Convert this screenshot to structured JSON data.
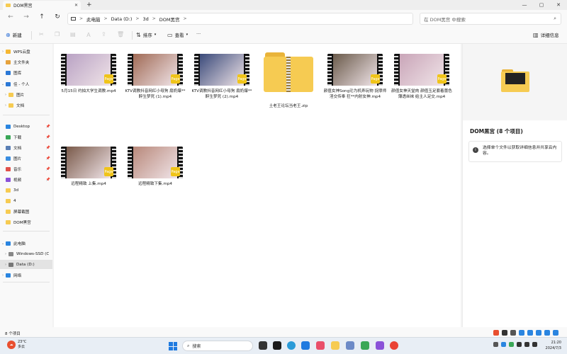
{
  "window": {
    "tab_title": "DOM黑宫",
    "tab_close": "✕",
    "new_tab": "+",
    "min": "—",
    "max": "▢",
    "close": "✕"
  },
  "nav": {
    "back": "←",
    "forward": "→",
    "up": "↑",
    "refresh": "↻"
  },
  "address": {
    "crumbs": [
      "此电脑",
      "Data (D:)",
      "3d",
      "DOM黑宫"
    ],
    "separator": ">"
  },
  "search": {
    "placeholder": "在 DOM黑宫 中搜索"
  },
  "toolbar": {
    "new_label": "新建",
    "sort_label": "排序",
    "view_label": "查看",
    "more_label": "···",
    "details_label": "详细信息"
  },
  "sidebar": {
    "items": [
      {
        "label": "WPS云盘",
        "color": "#f5b733"
      },
      {
        "label": "主文件夹",
        "color": "#e6a23c"
      },
      {
        "label": "图库",
        "color": "#2b78d6"
      },
      {
        "label": "佳 - 个人",
        "color": "#2b78d6"
      },
      {
        "label": "图片",
        "color": "#f6cb52"
      },
      {
        "label": "文档",
        "color": "#f6cb52"
      },
      {
        "label": "Desktop",
        "color": "#2a85e0"
      },
      {
        "label": "下载",
        "color": "#3aa757"
      },
      {
        "label": "文档",
        "color": "#5a7fb5"
      },
      {
        "label": "图片",
        "color": "#3a8de0"
      },
      {
        "label": "音乐",
        "color": "#e0504a"
      },
      {
        "label": "视频",
        "color": "#8a52d8"
      },
      {
        "label": "3d",
        "color": "#f6cb52"
      },
      {
        "label": "4",
        "color": "#f6cb52"
      },
      {
        "label": "屏幕截图",
        "color": "#f6cb52"
      },
      {
        "label": "DOM黑宫",
        "color": "#f6cb52"
      },
      {
        "label": "此电脑",
        "color": "#2a85e0"
      },
      {
        "label": "Windows-SSD (C",
        "color": "#888888"
      },
      {
        "label": "Data (D:)",
        "color": "#777777"
      },
      {
        "label": "网络",
        "color": "#2a85e0"
      }
    ]
  },
  "files": [
    {
      "name": "5月15日 约拍大学生调教.mp4",
      "type": "video",
      "tone": "#b9a2c4",
      "badge": "Page"
    },
    {
      "name": "KTV调教抖音网红小母狗 扇奶爆**  醉生梦死 (1).mp4",
      "type": "video",
      "tone": "#a06a55",
      "badge": "Page"
    },
    {
      "name": "KTV调教抖音网红小母狗 扇奶爆**  醉生梦死 (2).mp4",
      "type": "video",
      "tone": "#3a4a7a",
      "badge": "Page"
    },
    {
      "name": "土老王论坛当老王.zip",
      "type": "zip"
    },
    {
      "name": "颜值女神Song沦为机弄玩物 捉摩师淫交传奉 狂**内射女神.mp4",
      "type": "video",
      "tone": "#6a5a4a",
      "badge": "Page"
    },
    {
      "name": "颜值女神天堂肉 颜值玉足套着蕾色薄透丝袜 给主人足交.mp4",
      "type": "video",
      "tone": "#c9a5b8",
      "badge": "Page"
    },
    {
      "name": "远程精致 上集.mp4",
      "type": "video",
      "tone": "#7a5a4a",
      "badge": "Page"
    },
    {
      "name": "远程精致下集.mp4",
      "type": "video",
      "tone": "#b8887a",
      "badge": "Page"
    }
  ],
  "details": {
    "title": "DOM黑宫 (8 个项目)",
    "hint": "选择单个文件以获取详细信息并共享云内容。"
  },
  "status": {
    "count": "8 个项目"
  },
  "taskbar": {
    "temp": "23°C",
    "weather": "多云",
    "search": "搜索",
    "time": "21:20",
    "date": "2024/7/3"
  }
}
